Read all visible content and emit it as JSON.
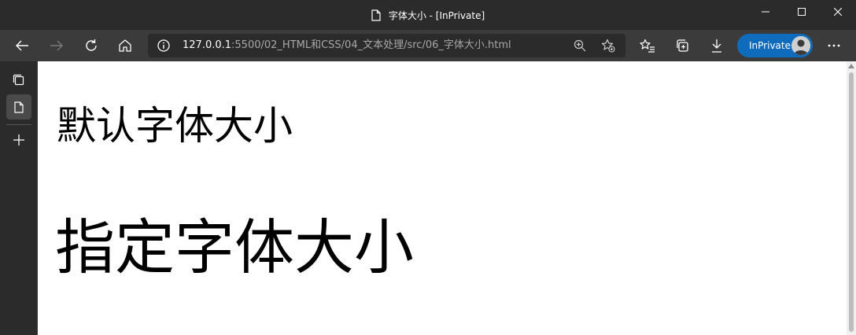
{
  "window": {
    "title": "字体大小 - [InPrivate]"
  },
  "toolbar": {
    "address": {
      "host": "127.0.0.1",
      "path": ":5500/02_HTML和CSS/04_文本处理/src/06_字体大小.html"
    },
    "inprivate_label": "InPrivate"
  },
  "page": {
    "text_default": "默认字体大小",
    "text_large": "指定字体大小"
  },
  "colors": {
    "titlebar": "#2b2b2b",
    "toolbar": "#3b3b3b",
    "inprivate": "#0f6cbd"
  },
  "icons": {
    "tab": "doc-icon",
    "back": "arrow-left-icon",
    "forward": "arrow-right-icon",
    "refresh": "refresh-icon",
    "home": "home-icon",
    "info": "info-icon",
    "zoom": "zoom-in-icon",
    "add_favorite": "star-add-icon",
    "favorites": "favorites-icon",
    "collections": "collections-icon",
    "downloads": "download-icon",
    "more": "more-icon"
  }
}
